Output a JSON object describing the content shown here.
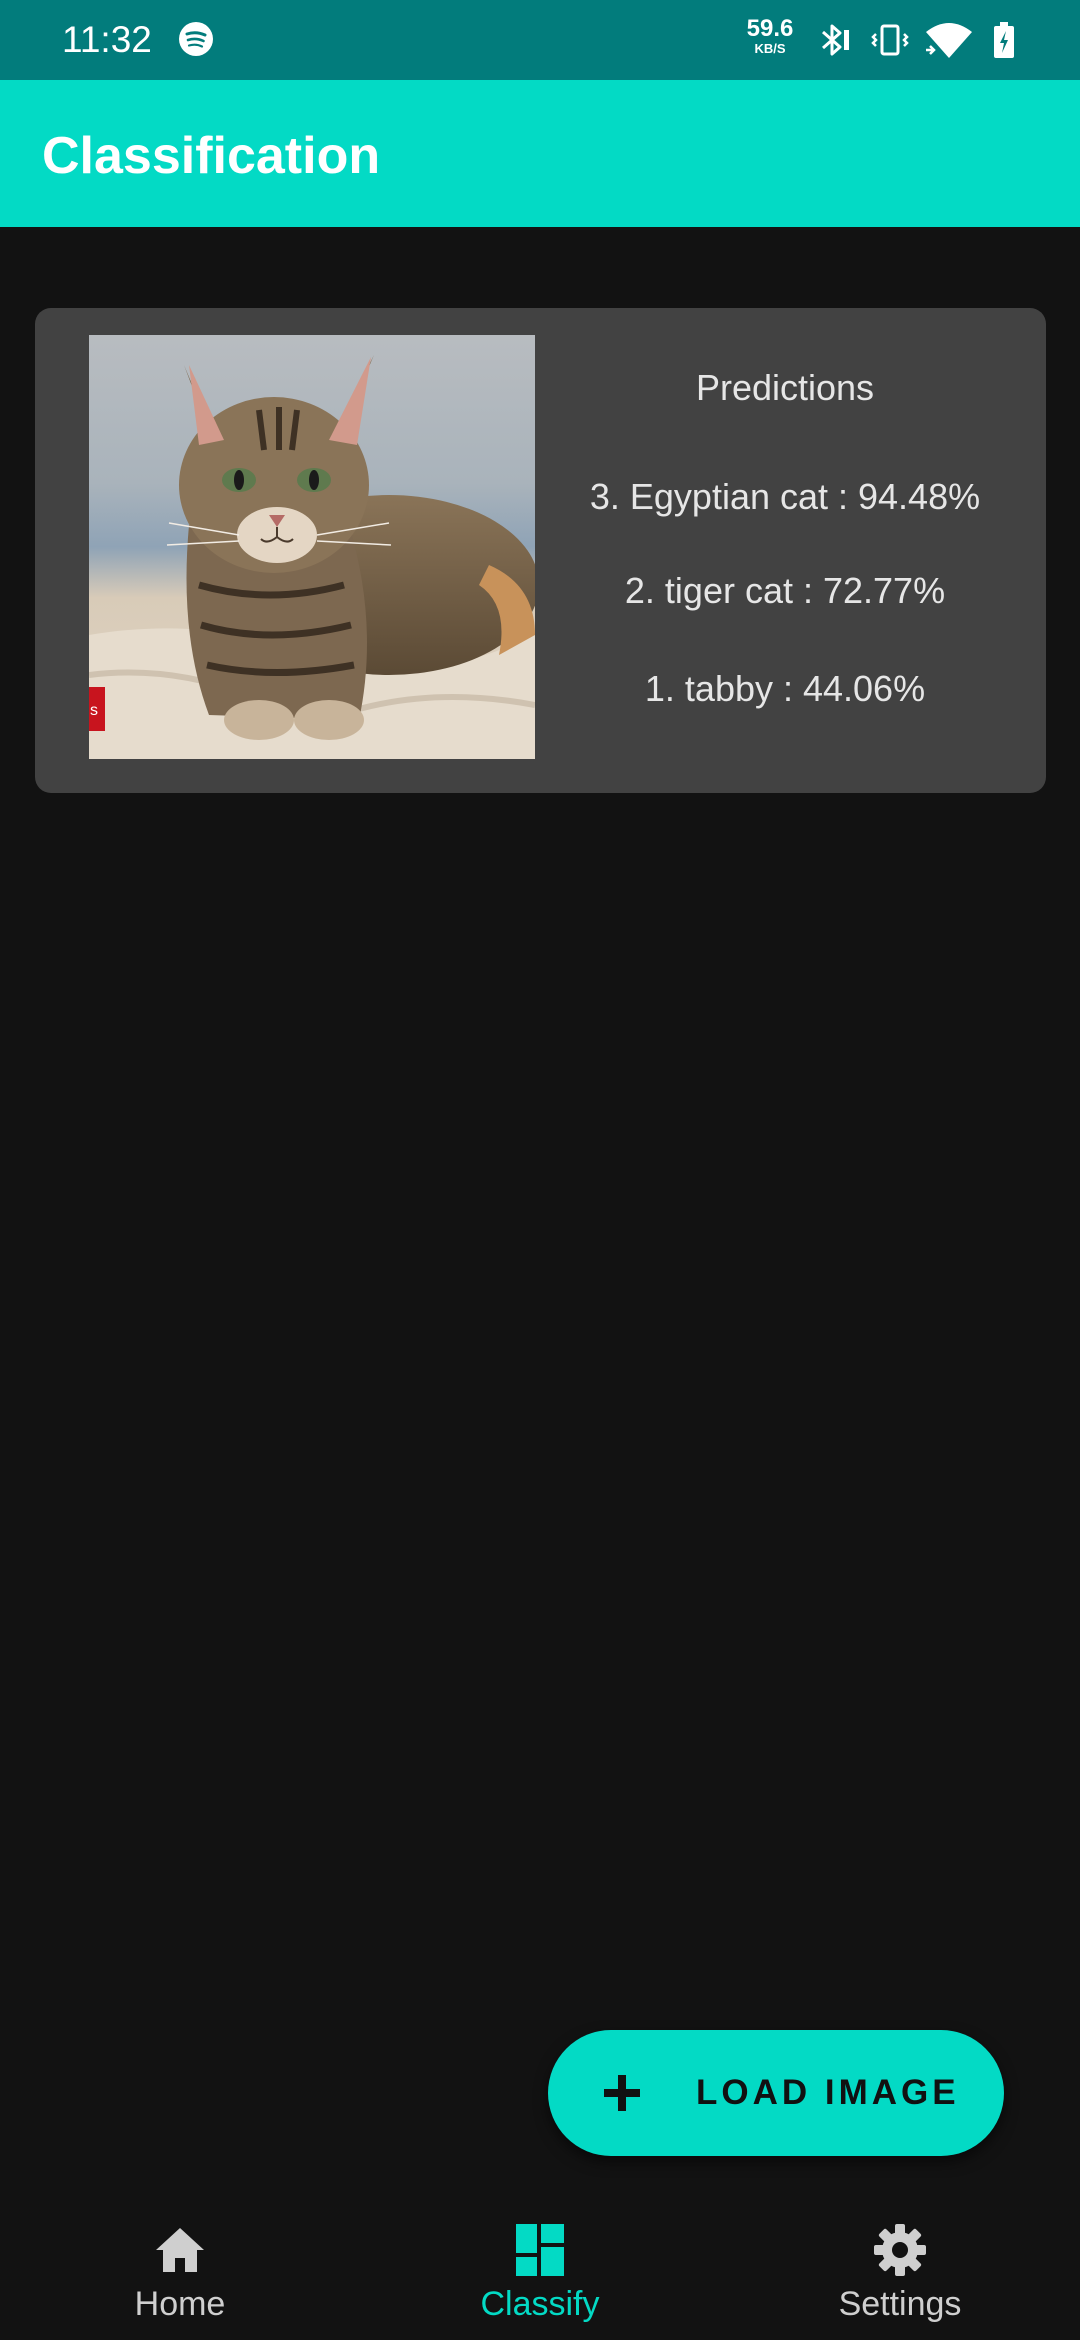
{
  "status_bar": {
    "time": "11:32",
    "net_speed_value": "59.6",
    "net_speed_unit": "KB/S",
    "icons": [
      "spotify-icon",
      "bluetooth-icon",
      "vibrate-icon",
      "wifi-icon",
      "battery-charging-icon"
    ]
  },
  "app_bar": {
    "title": "Classification"
  },
  "card": {
    "image_icon": "cat-photo",
    "predictions_title": "Predictions",
    "predictions": [
      "3. Egyptian cat : 94.48%",
      "2. tiger cat : 72.77%",
      "1. tabby : 44.06%"
    ]
  },
  "fab": {
    "icon": "plus-icon",
    "label": "LOAD IMAGE"
  },
  "bottom_nav": {
    "items": [
      {
        "label": "Home",
        "icon": "home-icon",
        "active": false
      },
      {
        "label": "Classify",
        "icon": "dashboard-icon",
        "active": true
      },
      {
        "label": "Settings",
        "icon": "gear-icon",
        "active": false
      }
    ]
  },
  "colors": {
    "status_bar": "#027c7c",
    "accent": "#03dac5",
    "background": "#121212",
    "card": "#424242"
  }
}
